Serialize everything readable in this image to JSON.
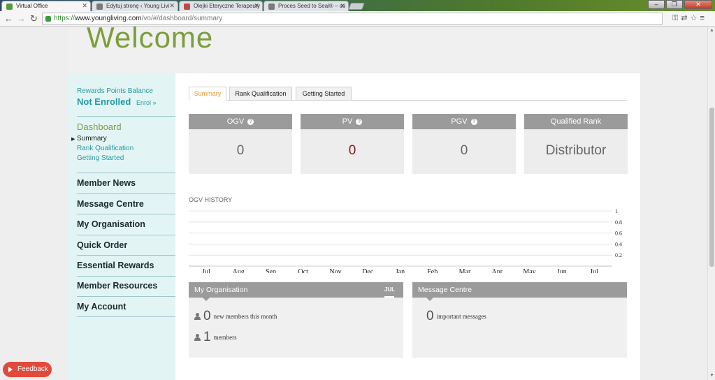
{
  "browser": {
    "tabs": [
      {
        "title": "Virtual Office",
        "active": true,
        "favicon_color": "#5a9a3a"
      },
      {
        "title": "Edytuj stronę ‹ Young Livi",
        "active": false,
        "favicon_color": "#7a7a7a"
      },
      {
        "title": "Olejki Eteryczne Terapeuty",
        "active": false,
        "favicon_color": "#c04a4a"
      },
      {
        "title": "Proces Seed to Seal® – co",
        "active": false,
        "favicon_color": "#7a7a7a"
      }
    ],
    "url_scheme": "https://",
    "url_host": "www.youngliving.com",
    "url_path": "/vo/#/dashboard/summary"
  },
  "header": {
    "title": "Welcome"
  },
  "sidebar": {
    "rewards_label": "Rewards Points Balance",
    "rewards_status": "Not Enrolled",
    "enrol_link": "Enrol »",
    "dashboard_title": "Dashboard",
    "dashboard_items": [
      "Summary",
      "Rank Qualification",
      "Getting Started"
    ],
    "menu": [
      "Member News",
      "Message Centre",
      "My Organisation",
      "Quick Order",
      "Essential Rewards",
      "Member Resources",
      "My Account"
    ]
  },
  "main": {
    "tabs": [
      "Summary",
      "Rank Qualification",
      "Getting Started"
    ],
    "stats": [
      {
        "label": "OGV",
        "value": "0",
        "help": "?"
      },
      {
        "label": "PV",
        "value": "0",
        "help": "?"
      },
      {
        "label": "PGV",
        "value": "0",
        "help": "?"
      },
      {
        "label": "Qualified Rank",
        "value": "Distributor"
      }
    ],
    "history_title": "OGV HISTORY",
    "organisation": {
      "title": "My Organisation",
      "month": "JUL",
      "new_members_count": "0",
      "new_members_text": "new members this month",
      "members_count": "1",
      "members_text": "members"
    },
    "messages": {
      "title": "Message Centre",
      "count": "0",
      "text": "important messages"
    }
  },
  "chart_data": {
    "type": "line",
    "title": "OGV HISTORY",
    "categories": [
      "Jul",
      "Aug",
      "Sep",
      "Oct",
      "Nov",
      "Dec",
      "Jan",
      "Feb",
      "Mar",
      "Apr",
      "May",
      "Jun",
      "Jul"
    ],
    "series": [
      {
        "values": [
          0,
          0,
          0,
          0,
          0,
          0,
          0,
          0,
          0,
          0,
          0,
          0,
          0
        ]
      }
    ],
    "yticks": [
      "0.2",
      "0.4",
      "0.6",
      "0.8",
      "1"
    ],
    "ylim": [
      0,
      1
    ],
    "grid": true
  },
  "feedback": {
    "label": "Feedback"
  },
  "colors": {
    "accent_green": "#7b9e3c",
    "teal": "#1f9aa3",
    "pv_red": "#8a1a1a",
    "feedback": "#e04a3a"
  }
}
